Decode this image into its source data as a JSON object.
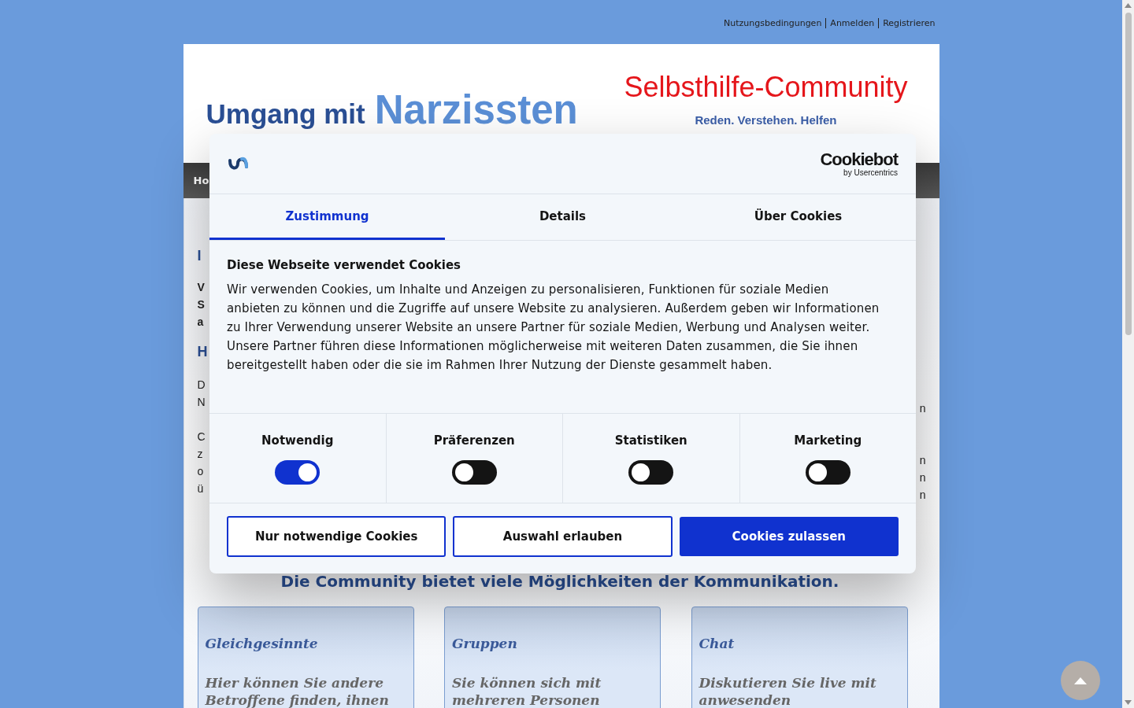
{
  "top_links": [
    {
      "label": "Nutzungsbedingungen"
    },
    {
      "label": "Anmelden"
    },
    {
      "label": "Registrieren"
    }
  ],
  "header": {
    "title_start": "Umgang mit",
    "title_end": "Narzissten",
    "community": "Selbsthilfe-Community",
    "slogan": "Reden. Verstehen. Helfen"
  },
  "nav": {
    "items": [
      {
        "label": "Ho"
      }
    ]
  },
  "content": {
    "left_fragments": [
      {
        "kind": "heading",
        "text": "I"
      },
      {
        "kind": "bold",
        "text": "V"
      },
      {
        "kind": "bold",
        "text": "S"
      },
      {
        "kind": "bold",
        "text": "a"
      },
      {
        "kind": "heading",
        "text": "H"
      },
      {
        "kind": "text",
        "text": "D"
      },
      {
        "kind": "text",
        "text": "N"
      },
      {
        "kind": "gap"
      },
      {
        "kind": "text",
        "text": "C"
      },
      {
        "kind": "text",
        "text": "z"
      },
      {
        "kind": "text",
        "text": "o"
      },
      {
        "kind": "text",
        "text": "ü"
      }
    ],
    "right_fragments": [
      {
        "kind": "text",
        "text": "n"
      },
      {
        "kind": "gap"
      },
      {
        "kind": "gap"
      },
      {
        "kind": "text",
        "text": "n"
      },
      {
        "kind": "text",
        "text": "n"
      },
      {
        "kind": "text",
        "text": "n"
      }
    ],
    "headline": "Die Community bietet viele Möglichkeiten der Kommunikation.",
    "cards": [
      {
        "title": "Gleichgesinnte",
        "lines": [
          "Hier können Sie andere",
          "Betroffene finden, ihnen"
        ]
      },
      {
        "title": "Gruppen",
        "lines": [
          "Sie können sich mit",
          "mehreren Personen"
        ]
      },
      {
        "title": "Chat",
        "lines": [
          "Diskutieren Sie live mit",
          "anwesenden"
        ]
      }
    ]
  },
  "cookie_dialog": {
    "brand": "Cookiebot",
    "brand_sub": "by Usercentrics",
    "tabs": [
      {
        "label": "Zustimmung",
        "selected": true
      },
      {
        "label": "Details",
        "selected": false
      },
      {
        "label": "Über Cookies",
        "selected": false
      }
    ],
    "title": "Diese Webseite verwendet Cookies",
    "text": "Wir verwenden Cookies, um Inhalte und Anzeigen zu personalisieren, Funktionen für soziale Medien anbieten zu können und die Zugriffe auf unsere Website zu analysieren. Außerdem geben wir Informationen zu Ihrer Verwendung unserer Website an unsere Partner für soziale Medien, Werbung und Analysen weiter. Unsere Partner führen diese Informationen möglicherweise mit weiteren Daten zusammen, die Sie ihnen bereitgestellt haben oder die sie im Rahmen Ihrer Nutzung der Dienste gesammelt haben.",
    "categories": [
      {
        "label": "Notwendig",
        "on": true
      },
      {
        "label": "Präferenzen",
        "on": false
      },
      {
        "label": "Statistiken",
        "on": false
      },
      {
        "label": "Marketing",
        "on": false
      }
    ],
    "buttons": [
      {
        "label": "Nur notwendige Cookies",
        "kind": "outline"
      },
      {
        "label": "Auswahl erlauben",
        "kind": "outline"
      },
      {
        "label": "Cookies zulassen",
        "kind": "primary"
      }
    ]
  }
}
